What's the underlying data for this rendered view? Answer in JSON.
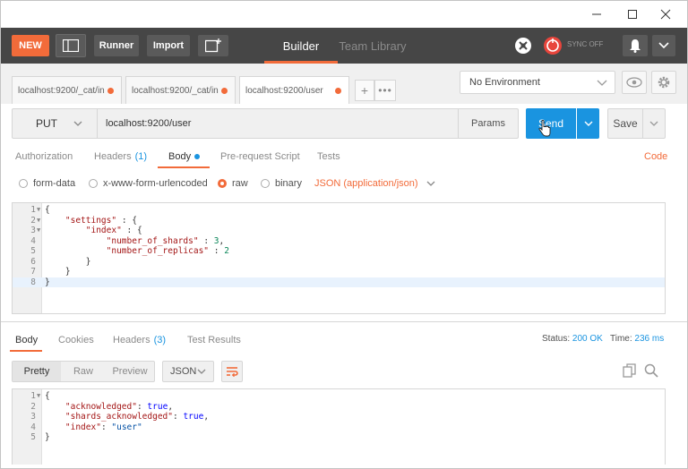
{
  "window": {
    "minimize": "—",
    "maximize": "☐",
    "close": "✕"
  },
  "header": {
    "new_label": "NEW",
    "runner_label": "Runner",
    "import_label": "Import",
    "tabs": [
      {
        "label": "Builder",
        "active": true
      },
      {
        "label": "Team Library",
        "active": false
      }
    ],
    "sync_label": "SYNC OFF",
    "accent_color": "#f26b3a"
  },
  "request_tabs": [
    {
      "label": "localhost:9200/_cat/in",
      "unsaved": true
    },
    {
      "label": "localhost:9200/_cat/in",
      "unsaved": true
    },
    {
      "label": "localhost:9200/user",
      "unsaved": true,
      "active": true
    }
  ],
  "environment": {
    "selected": "No Environment"
  },
  "request": {
    "method": "PUT",
    "url": "localhost:9200/user",
    "params_label": "Params",
    "send_label": "Send",
    "save_label": "Save"
  },
  "request_subtabs": [
    {
      "label": "Authorization"
    },
    {
      "label": "Headers",
      "count": "(1)"
    },
    {
      "label": "Body",
      "active": true
    },
    {
      "label": "Pre-request Script"
    },
    {
      "label": "Tests"
    }
  ],
  "code_link": "Code",
  "body_types": [
    {
      "label": "form-data",
      "selected": false
    },
    {
      "label": "x-www-form-urlencoded",
      "selected": false
    },
    {
      "label": "raw",
      "selected": true
    },
    {
      "label": "binary",
      "selected": false
    }
  ],
  "body_format": "JSON (application/json)",
  "request_body_lines": [
    {
      "n": "1",
      "fold": true,
      "text": "{"
    },
    {
      "n": "2",
      "fold": true,
      "text": "    \"settings\" : {"
    },
    {
      "n": "3",
      "fold": true,
      "text": "        \"index\" : {"
    },
    {
      "n": "4",
      "fold": false,
      "text": "            \"number_of_shards\" : 3,"
    },
    {
      "n": "5",
      "fold": false,
      "text": "            \"number_of_replicas\" : 2"
    },
    {
      "n": "6",
      "fold": false,
      "text": "        }"
    },
    {
      "n": "7",
      "fold": false,
      "text": "    }"
    },
    {
      "n": "8",
      "fold": false,
      "text": "}"
    }
  ],
  "response_tabs": [
    {
      "label": "Body",
      "active": true
    },
    {
      "label": "Cookies"
    },
    {
      "label": "Headers",
      "count": "(3)"
    },
    {
      "label": "Test Results"
    }
  ],
  "response_status": {
    "status_label": "Status:",
    "status_value": "200 OK",
    "time_label": "Time:",
    "time_value": "236 ms"
  },
  "response_view": {
    "modes": [
      "Pretty",
      "Raw",
      "Preview"
    ],
    "active_mode": "Pretty",
    "language": "JSON"
  },
  "response_body_lines": [
    {
      "n": "1",
      "fold": true,
      "text": "{"
    },
    {
      "n": "2",
      "fold": false,
      "text": "    \"acknowledged\": true,"
    },
    {
      "n": "3",
      "fold": false,
      "text": "    \"shards_acknowledged\": true,"
    },
    {
      "n": "4",
      "fold": false,
      "text": "    \"index\": \"user\""
    },
    {
      "n": "5",
      "fold": false,
      "text": "}"
    }
  ]
}
